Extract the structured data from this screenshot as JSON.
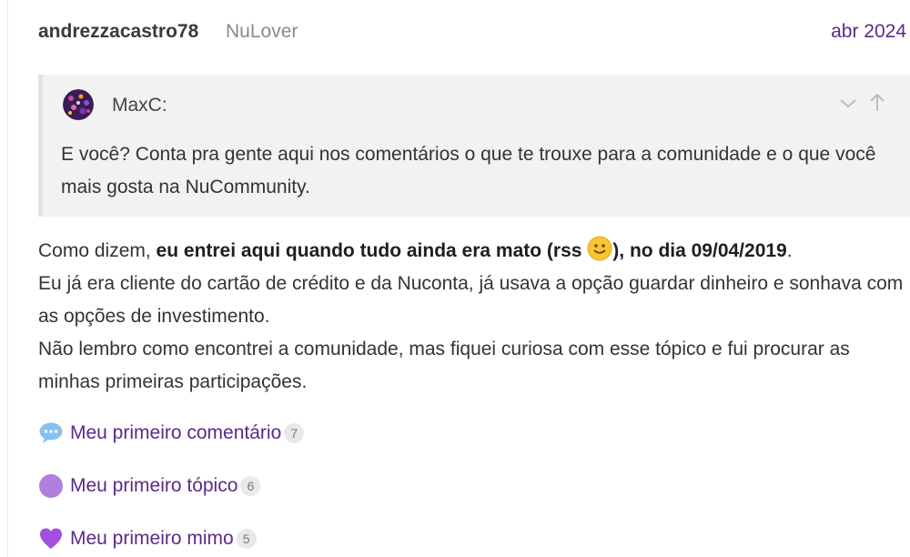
{
  "post": {
    "username": "andrezzacastro78",
    "user_title": "NuLover",
    "date": "abr 2024"
  },
  "quote": {
    "author": "MaxC:",
    "text": "E você? Conta pra gente aqui nos comentários o que te trouxe para a comunidade e o que você mais gosta na NuCommunity.",
    "icons": {
      "expand": "chevron-down-icon",
      "jump": "arrow-up-icon",
      "avatar": "avatar"
    }
  },
  "body": {
    "p1_intro": "Como dizem, ",
    "p1_bold_a": "eu entrei aqui quando tudo ainda era mato (rss ",
    "p1_bold_b": "), no dia 09/04/2019",
    "p1_end": ".",
    "p2": "Eu já era cliente do cartão de crédito e da Nuconta, já usava a opção guardar dinheiro e sonhava com as opções de investimento.",
    "p3": "Não lembro como encontrei a comunidade, mas fiquei curiosa com esse tópico e fui procurar as minhas primeiras participações.",
    "emoji": "slightly-smiling-face-icon"
  },
  "links": [
    {
      "icon": "speech-balloon-icon",
      "label": "Meu primeiro comentário",
      "count": "7"
    },
    {
      "icon": "purple-circle-icon",
      "label": "Meu primeiro tópico",
      "count": "6"
    },
    {
      "icon": "purple-heart-icon",
      "label": "Meu primeiro mimo",
      "count": "5"
    }
  ],
  "colors": {
    "accent": "#5b2a86",
    "quote_bg": "#f2f2f2",
    "muted": "#8a8a8a"
  }
}
